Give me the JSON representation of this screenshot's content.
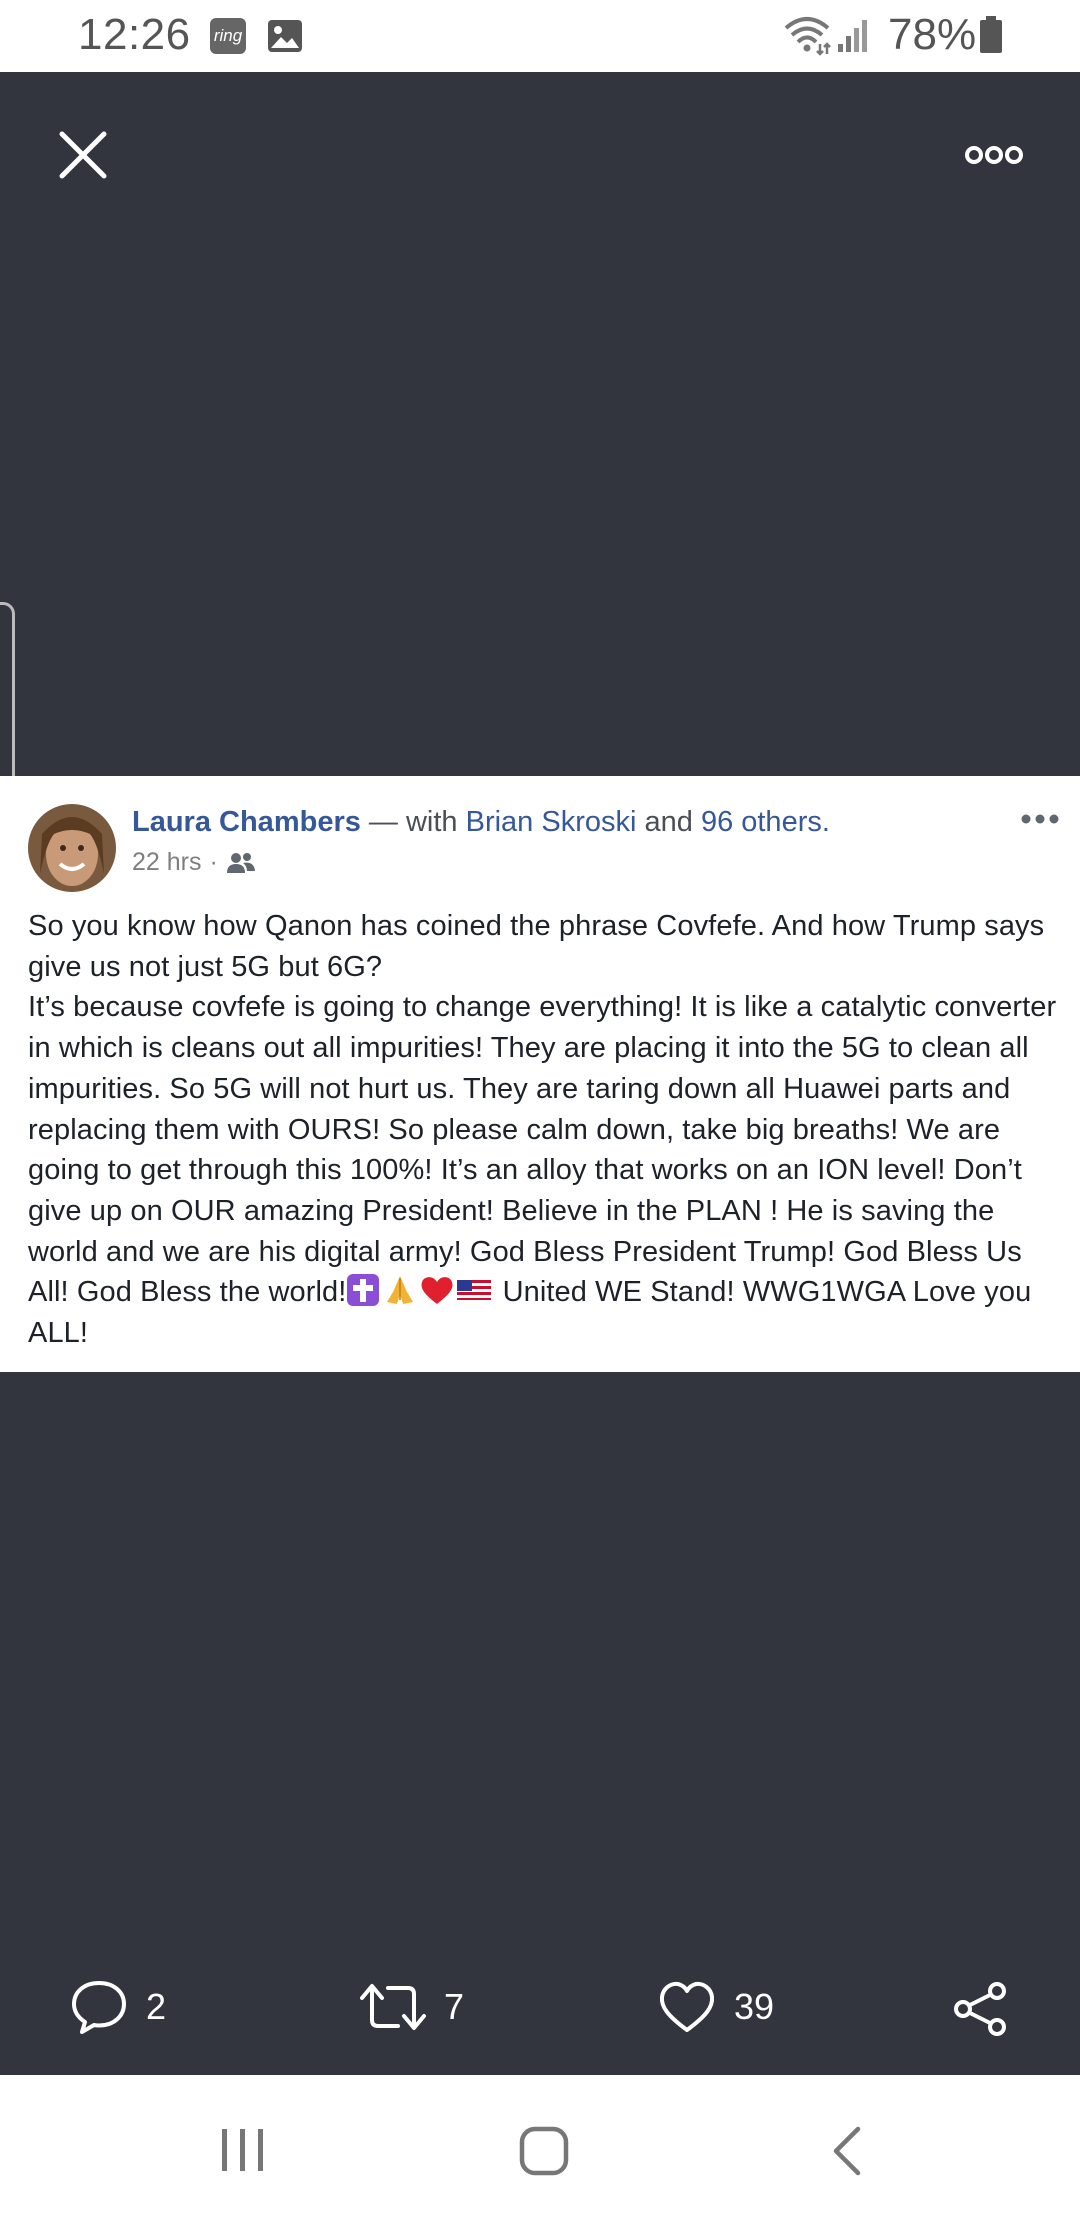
{
  "status_bar": {
    "time": "12:26",
    "ring_label": "ring",
    "battery": "78%"
  },
  "post": {
    "author": "Laura Chambers",
    "with_separator": " — with ",
    "tagged_person": "Brian Skroski",
    "and_text": " and ",
    "others": "96 others.",
    "time": "22 hrs",
    "dot": "·",
    "audience_icon": "friends-icon",
    "text_main": "So you know how Qanon has coined the phrase Covfefe. And how Trump says give us not just 5G but 6G?\nIt’s because covfefe is going to change everything! It is like a catalytic converter in which is cleans out all impurities! They are placing it into the 5G to clean all impurities. So 5G will not hurt us. They are taring down all Huawei parts and replacing them with OURS! So please calm down, take big breaths! We are going to get through this 100%! It’s an alloy that works on an ION level! Don’t give up on OUR amazing President! Believe in the PLAN ! He is saving the world and we are his digital army! God Bless President Trump! God Bless Us All! God Bless the world!",
    "text_end": " United WE Stand! WWG1WGA Love you ALL!",
    "emojis": [
      "latin-cross-emoji",
      "folded-hands-emoji",
      "red-heart-emoji",
      "us-flag-emoji"
    ]
  },
  "actions": {
    "comments": "2",
    "retweets": "7",
    "likes": "39"
  },
  "colors": {
    "viewer_bg": "#32353e",
    "link": "#365899",
    "status_text": "#555555"
  }
}
